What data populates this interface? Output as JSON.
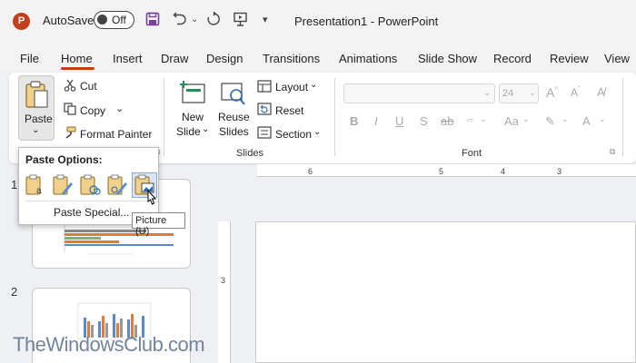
{
  "titlebar": {
    "logo_letter": "P",
    "autosave_label": "AutoSave",
    "autosave_state": "Off",
    "doc_title": "Presentation1  -  PowerPoint"
  },
  "tabs": [
    "File",
    "Home",
    "Insert",
    "Draw",
    "Design",
    "Transitions",
    "Animations",
    "Slide Show",
    "Record",
    "Review",
    "View"
  ],
  "active_tab": "Home",
  "accent_color": "#c43e1c",
  "clipboard": {
    "paste_label": "Paste",
    "cut_label": "Cut",
    "copy_label": "Copy",
    "format_painter_label": "Format Painter"
  },
  "slides_group": {
    "new_slide_label_1": "New",
    "new_slide_label_2": "Slide",
    "reuse_label_1": "Reuse",
    "reuse_label_2": "Slides",
    "layout_label": "Layout",
    "reset_label": "Reset",
    "section_label": "Section",
    "group_label": "Slides"
  },
  "font_group": {
    "size_value": "24",
    "bold": "B",
    "italic": "I",
    "underline": "U",
    "strike": "S",
    "spacing": "ab",
    "case": "Aa",
    "color_a": "A",
    "group_label": "Font"
  },
  "ruler": {
    "ticks": [
      "6",
      "5",
      "4",
      "3"
    ],
    "vertical_tick": "3"
  },
  "thumbnails": [
    {
      "number": "1"
    },
    {
      "number": "2"
    }
  ],
  "paste_popup": {
    "title": "Paste Options:",
    "options": [
      "use-destination-theme",
      "keep-source-formatting",
      "embed",
      "keep-source-formatting-embed",
      "picture"
    ],
    "selected": "picture",
    "special_label": "Paste Special..."
  },
  "tooltip": "Picture (U)",
  "watermark": "TheWindowsClub.com"
}
